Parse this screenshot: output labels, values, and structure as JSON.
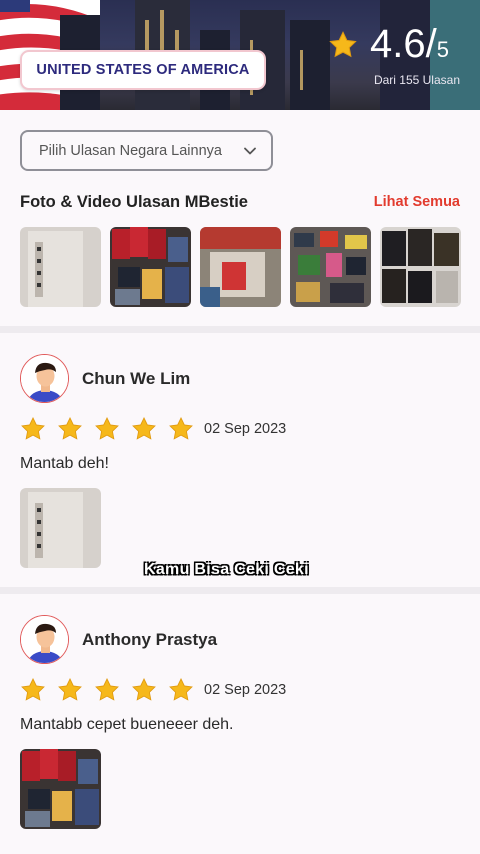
{
  "header": {
    "country": "UNITED STATES OF AMERICA",
    "rating_value": "4.6/",
    "rating_max": "5",
    "review_count": "Dari 155 Ulasan",
    "star_icon": "star-icon"
  },
  "filter": {
    "dropdown_label": "Pilih Ulasan Negara Lainnya",
    "chevron_icon": "chevron-down-icon"
  },
  "media": {
    "title": "Foto & Video Ulasan MBestie",
    "see_all": "Lihat Semua",
    "thumbnail_count": 5
  },
  "reviews": [
    {
      "name": "Chun We Lim",
      "rating": 5,
      "date": "02 Sep 2023",
      "text": "Mantab deh!"
    },
    {
      "name": "Anthony Prastya",
      "rating": 5,
      "date": "02 Sep 2023",
      "text": "Mantabb cepet bueneeer deh."
    }
  ],
  "overlay": {
    "caption": "Kamu Bisa Ceki Ceki"
  },
  "colors": {
    "accent_red": "#e23b2e",
    "country_text": "#2d2a7d",
    "star_gold": "#f6b81a"
  }
}
